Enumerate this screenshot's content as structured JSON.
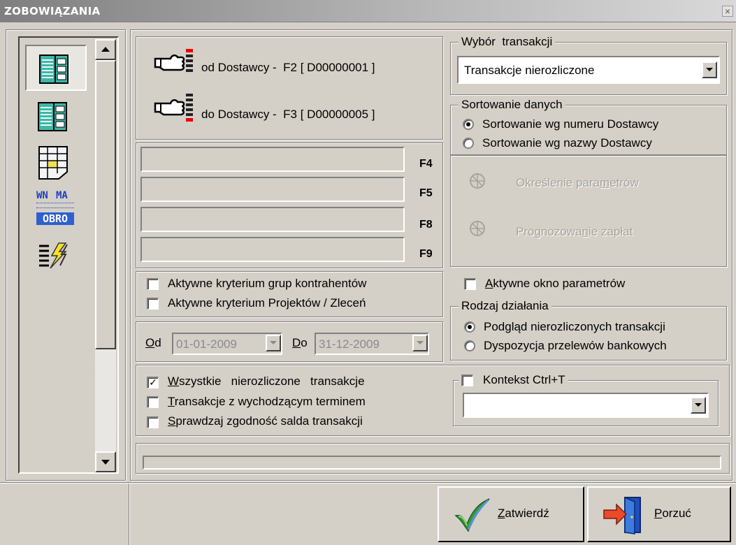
{
  "window": {
    "title": "ZOBOWIĄZANIA",
    "close_glyph": "×"
  },
  "sidebar": {
    "icons": [
      "list-grid-icon",
      "list-grid-icon",
      "document-table-icon",
      "wn-ma-obro-icon",
      "lines-lightning-icon"
    ],
    "wn_text": "WN",
    "ma_text": "MA",
    "obro_text": "OBRO"
  },
  "range": {
    "from_label": "od Dostawcy -",
    "from_key": "F2 [ D00000001 ]",
    "to_label": "do Dostawcy -",
    "to_key": "F3 [ D00000005 ]"
  },
  "filters": [
    {
      "key": "F4",
      "value": ""
    },
    {
      "key": "F5",
      "value": ""
    },
    {
      "key": "F8",
      "value": ""
    },
    {
      "key": "F9",
      "value": ""
    }
  ],
  "criteria": {
    "groups_label": "Aktywne kryterium grup kontrahentów",
    "groups_checked": false,
    "projects_label": "Aktywne kryterium Projektów / Zleceń",
    "projects_checked": false
  },
  "dates": {
    "od_label": "Od",
    "od_value": "01-01-2009",
    "do_label": "Do",
    "do_value": "31-12-2009"
  },
  "options": {
    "all_label": "Wszystkie   nierozliczone   transakcje",
    "all_checked": true,
    "expiring_label": "Transakcje z wychodzącym terminem",
    "expiring_checked": false,
    "check_balance_label": "Sprawdzaj zgodność salda transakcji",
    "check_balance_checked": false
  },
  "transaction_choice": {
    "group_label": "Wybór  transakcji",
    "selected": "Transakcje nierozliczone"
  },
  "sorting": {
    "group_label": "Sortowanie danych",
    "options": [
      "Sortowanie wg numeru Dostawcy",
      "Sortowanie wg nazwy Dostawcy"
    ],
    "selected_index": 0
  },
  "parameters": {
    "define_label": "Określenie parametrów",
    "forecast_label": "Prognozowanie zapłat",
    "active_window_label": "Aktywne okno parametrów",
    "active_window_checked": false
  },
  "action": {
    "group_label": "Rodzaj działania",
    "options": [
      "Podgląd nierozliczonych transakcji",
      "Dyspozycja przelewów bankowych"
    ],
    "selected_index": 0
  },
  "context": {
    "label": "Kontekst Ctrl+T",
    "checked": false,
    "value": ""
  },
  "buttons": {
    "confirm": "Zatwierdź",
    "cancel": "Porzuć"
  },
  "colors": {
    "face": "#d4d0c8",
    "shadow": "#808080",
    "teal": "#3fb6a8",
    "blue": "#1f3fbf"
  }
}
